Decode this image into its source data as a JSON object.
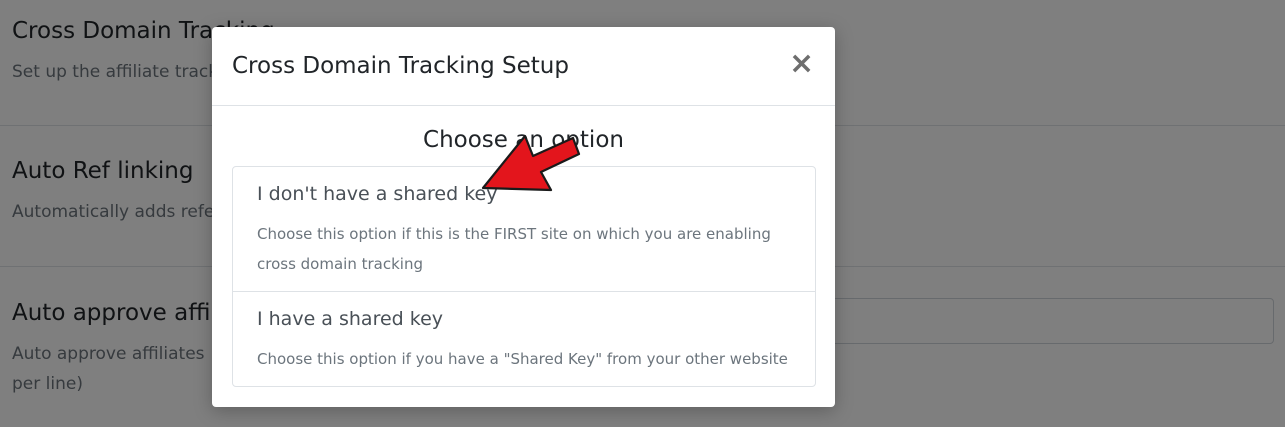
{
  "background": {
    "settings": [
      {
        "title": "Cross Domain Tracking",
        "description": "Set up the affiliate tracking"
      },
      {
        "title": "Auto Ref linking",
        "description": "Automatically adds referral"
      },
      {
        "title": "Auto approve affiliates",
        "description": "Auto approve affiliates",
        "description_line2": "per line)"
      }
    ]
  },
  "modal": {
    "title": "Cross Domain Tracking Setup",
    "close_symbol": "×",
    "heading": "Choose an option",
    "options": [
      {
        "title": "I don't have a shared key",
        "description": "Choose this option if this is the FIRST site on which you are enabling cross domain tracking"
      },
      {
        "title": "I have a shared key",
        "description": "Choose this option if you have a \"Shared Key\" from your other website"
      }
    ]
  },
  "colors": {
    "arrow": "#e3151c",
    "backdrop": "rgba(0,0,0,0.5)"
  },
  "icons": {
    "close": "close-icon",
    "pointer": "arrow-pointer-icon"
  }
}
